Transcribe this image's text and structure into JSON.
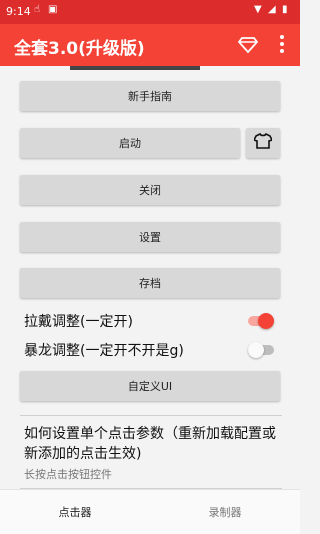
{
  "status_bar": {
    "time": "9:14"
  },
  "app_bar": {
    "title": "全套3.0(升级版)",
    "icons": [
      "diamond-icon",
      "more-vert-icon"
    ]
  },
  "buttons": {
    "guide": "新手指南",
    "start": "启动",
    "close": "关闭",
    "settings": "设置",
    "archive": "存档",
    "custom_ui": "自定义UI"
  },
  "switches": [
    {
      "label": "拉戴调整(一定开)",
      "on": true
    },
    {
      "label": "暴龙调整(一定开不开是g)",
      "on": false
    }
  ],
  "info": {
    "title": "如何设置单个点击参数（重新加载配置或新添加的点击生效)",
    "subtitle": "长按点击按钮控件"
  },
  "bottom_nav": {
    "items": [
      "点击器",
      "录制器"
    ],
    "active": "点击器"
  },
  "colors": {
    "primary": "#f44336",
    "status_bar": "#dd2c2c",
    "button_bg": "#d8d8d8"
  }
}
